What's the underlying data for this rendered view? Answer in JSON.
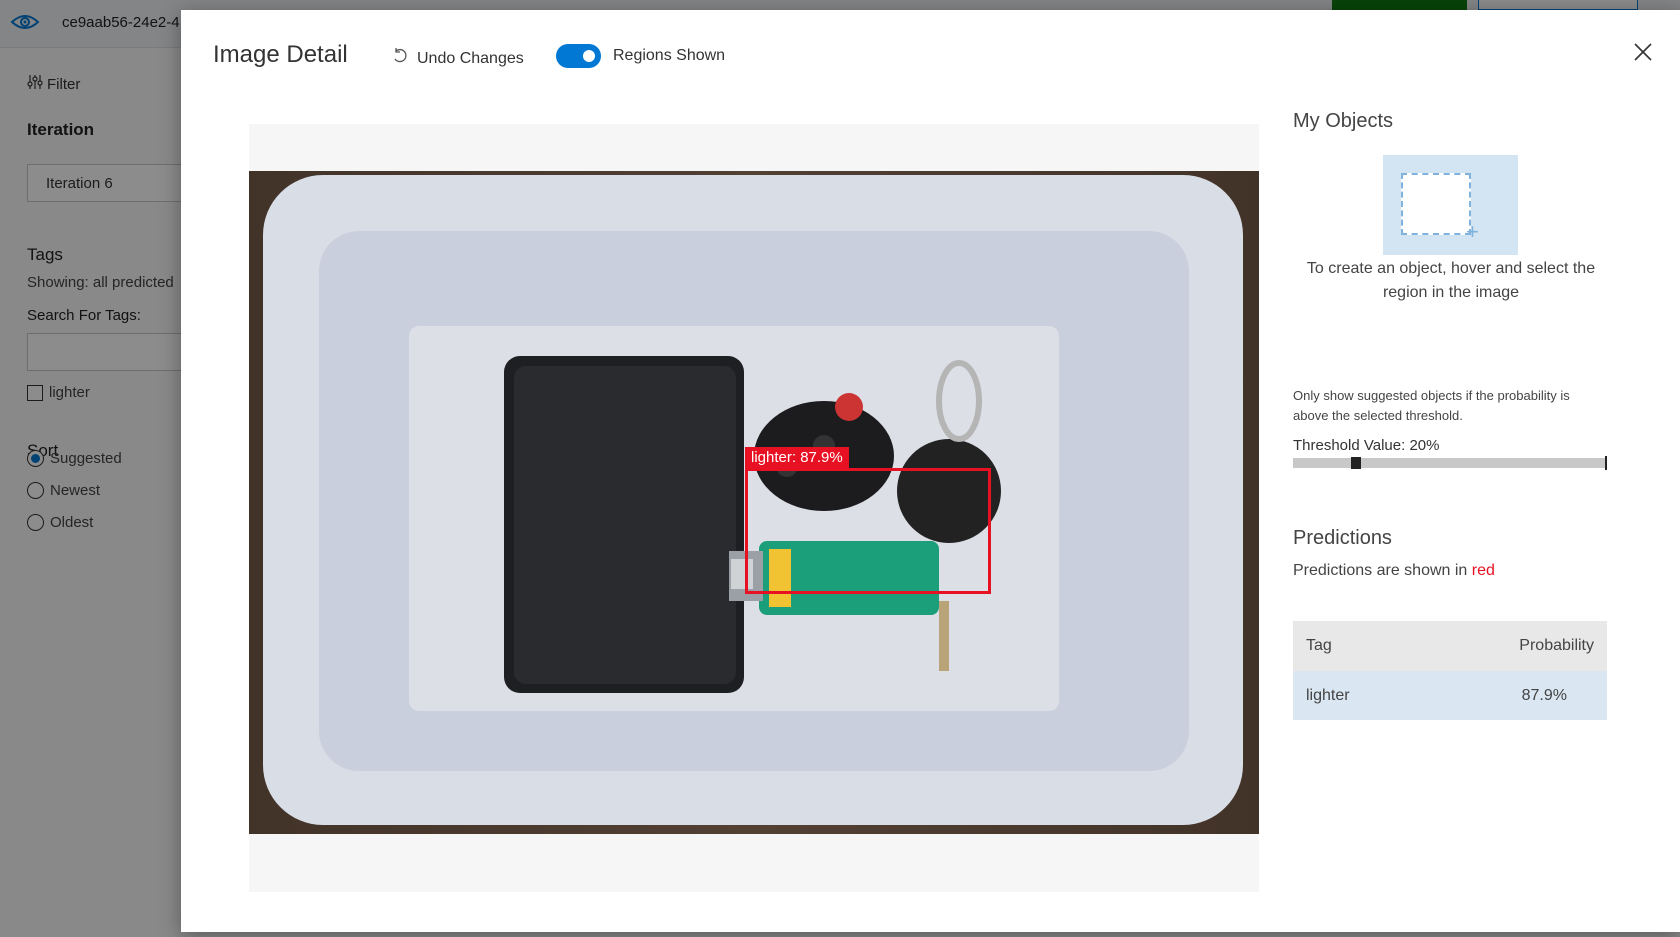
{
  "app": {
    "project_name": "ce9aab56-24e2-4",
    "filter_label": "Filter",
    "iteration_title": "Iteration",
    "iteration_value": "Iteration 6",
    "tags_title": "Tags",
    "showing_text": "Showing: all predicted",
    "search_label": "Search For Tags:",
    "search_value": "",
    "tag_items": [
      "lighter"
    ],
    "sort_title": "Sort",
    "sort_options": [
      "Suggested",
      "Newest",
      "Oldest"
    ],
    "sort_selected": "Suggested"
  },
  "modal": {
    "title": "Image Detail",
    "undo_label": "Undo Changes",
    "regions_label": "Regions Shown",
    "regions_on": true
  },
  "region": {
    "label": "lighter: 87.9%",
    "color": "#e81123"
  },
  "objects": {
    "title": "My Objects",
    "hint": "To create an object, hover and select the region in the image"
  },
  "threshold": {
    "note": "Only show suggested objects if the probability is above the selected threshold.",
    "label": "Threshold Value: 20%",
    "value": 0.2
  },
  "predictions": {
    "title": "Predictions",
    "subtitle_prefix": "Predictions are shown in",
    "subtitle_color_word": "red",
    "headers": {
      "tag": "Tag",
      "probability": "Probability"
    },
    "rows": [
      {
        "tag": "lighter",
        "probability": "87.9%"
      }
    ]
  },
  "colors": {
    "accent": "#0078d4",
    "prediction": "#e81123",
    "primary_button": "#107c10"
  }
}
